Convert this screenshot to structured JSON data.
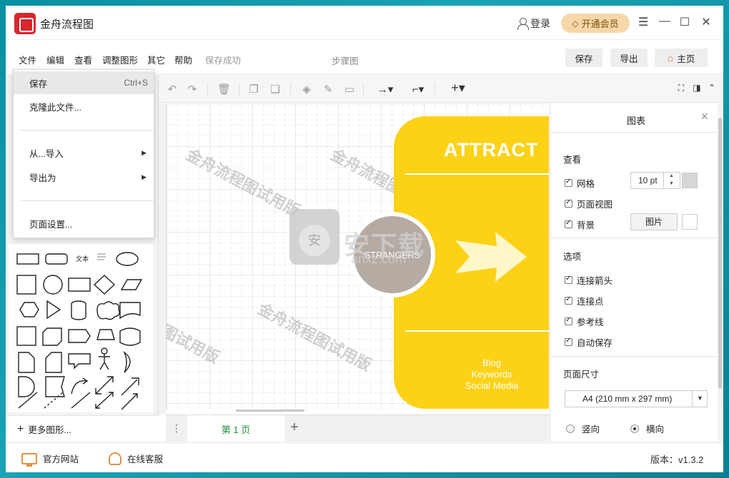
{
  "app": {
    "title": "金舟流程图",
    "login": "登录",
    "vip": "开通会员"
  },
  "window_controls": [
    "☰",
    "—",
    "☐",
    "✕"
  ],
  "menubar": {
    "items": [
      "文件",
      "编辑",
      "查看",
      "调整图形",
      "其它",
      "帮助"
    ],
    "status": "保存成功",
    "page_name": "步骤图",
    "buttons": {
      "save": "保存",
      "export": "导出",
      "home": "主页"
    }
  },
  "file_menu": {
    "save": "保存",
    "save_shortcut": "Ctrl+S",
    "clone": "克隆此文件...",
    "import_from": "从...导入",
    "export_as": "导出为",
    "page_setup": "页面设置..."
  },
  "shapes": {
    "text_label": "文本",
    "more": "更多图形..."
  },
  "canvas": {
    "watermark": "金舟流程图试用版",
    "watermark_partial": "图试用版",
    "attract_title": "ATTRACT",
    "strangers": "STRANGERS",
    "sub_items": [
      "Blog",
      "Keywords",
      "Social Media"
    ],
    "site_watermark": "安下载",
    "site_watermark_sub": "anxz.com",
    "block_color": "#fcd217"
  },
  "pages": {
    "current": "第 1 页"
  },
  "right_panel": {
    "title": "图表",
    "view_section": "查看",
    "grid": "网格",
    "grid_size": "10 pt",
    "page_view": "页面视图",
    "background": "背景",
    "image_button": "图片",
    "options_section": "选项",
    "connect_arrows": "连接箭头",
    "connect_points": "连接点",
    "guides": "参考线",
    "autosave": "自动保存",
    "page_size_section": "页面尺寸",
    "page_size": "A4 (210 mm x 297 mm)",
    "portrait": "竖向",
    "landscape": "横向",
    "selected_orientation": "横向"
  },
  "footer": {
    "website": "官方网站",
    "support": "在线客服",
    "version": "版本：v1.3.2"
  },
  "colors": {
    "accent_red": "#d8262b",
    "vip_bg": "#f6d8a8",
    "page_tab_green": "#1e8f3e",
    "footer_icon": "#e4914a"
  }
}
